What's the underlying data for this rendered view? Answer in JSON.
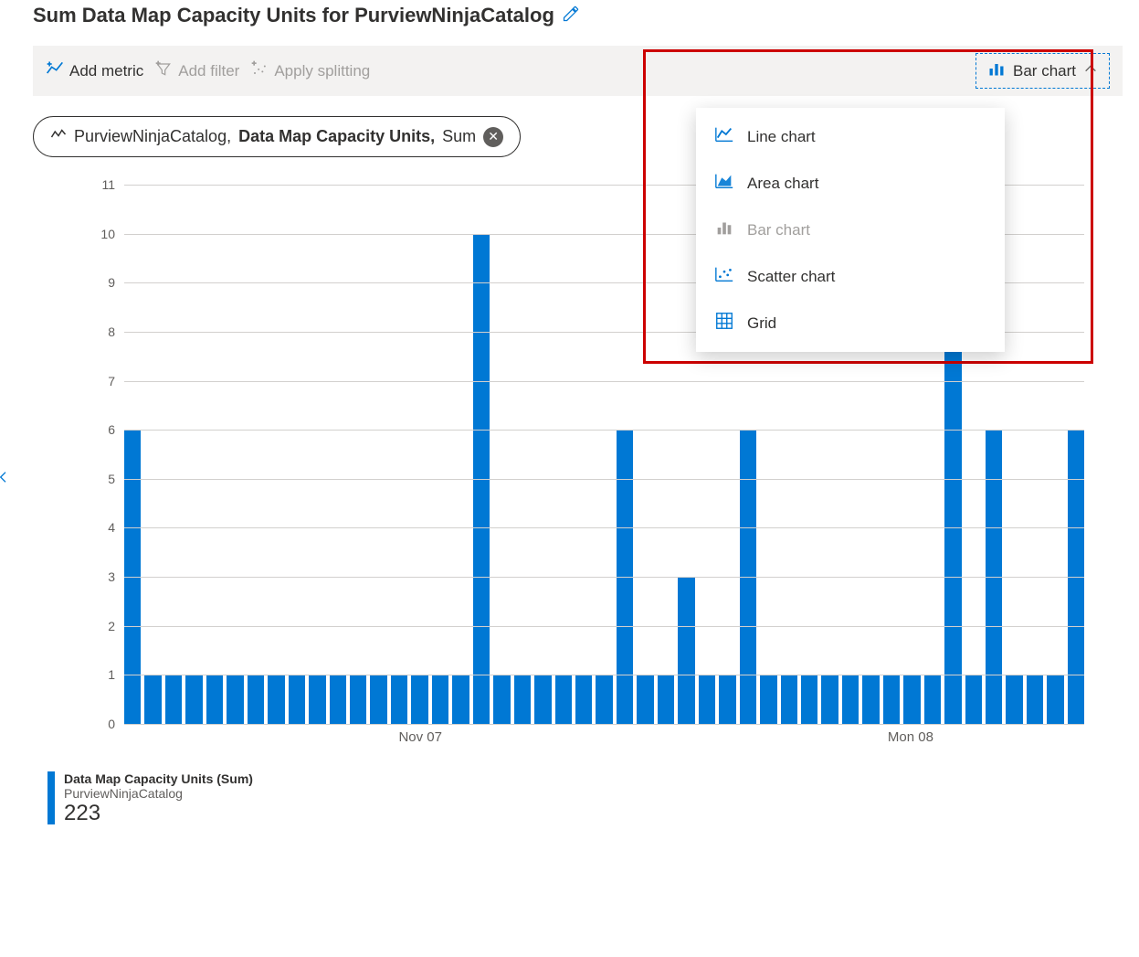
{
  "title": "Sum Data Map Capacity Units for PurviewNinjaCatalog",
  "toolbar": {
    "add_metric": "Add metric",
    "add_filter": "Add filter",
    "apply_splitting": "Apply splitting",
    "chart_type_selected": "Bar chart"
  },
  "metric_pill": {
    "resource": "PurviewNinjaCatalog,",
    "metric": "Data Map Capacity Units,",
    "aggregation": "Sum"
  },
  "chart_type_menu": [
    {
      "label": "Line chart",
      "disabled": false
    },
    {
      "label": "Area chart",
      "disabled": false
    },
    {
      "label": "Bar chart",
      "disabled": true
    },
    {
      "label": "Scatter chart",
      "disabled": false
    },
    {
      "label": "Grid",
      "disabled": false
    }
  ],
  "legend": {
    "title": "Data Map Capacity Units (Sum)",
    "subtitle": "PurviewNinjaCatalog",
    "value": "223"
  },
  "chart_data": {
    "type": "bar",
    "title": "Sum Data Map Capacity Units for PurviewNinjaCatalog",
    "ylabel": "",
    "xlabel": "",
    "ylim": [
      0,
      11
    ],
    "y_ticks": [
      0,
      1,
      2,
      3,
      4,
      5,
      6,
      7,
      8,
      9,
      10,
      11
    ],
    "x_tick_labels": [
      {
        "label": "Nov 07",
        "index": 14
      },
      {
        "label": "Mon 08",
        "index": 38
      }
    ],
    "values": [
      6,
      1,
      1,
      1,
      1,
      1,
      1,
      1,
      1,
      1,
      1,
      1,
      1,
      1,
      1,
      1,
      1,
      10,
      1,
      1,
      1,
      1,
      1,
      1,
      6,
      1,
      1,
      3,
      1,
      1,
      6,
      1,
      1,
      1,
      1,
      1,
      1,
      1,
      1,
      1,
      9,
      1,
      6,
      1,
      1,
      1,
      6
    ],
    "annotations": []
  },
  "colors": {
    "bar": "#0078d4",
    "annotation_box": "#c00"
  }
}
